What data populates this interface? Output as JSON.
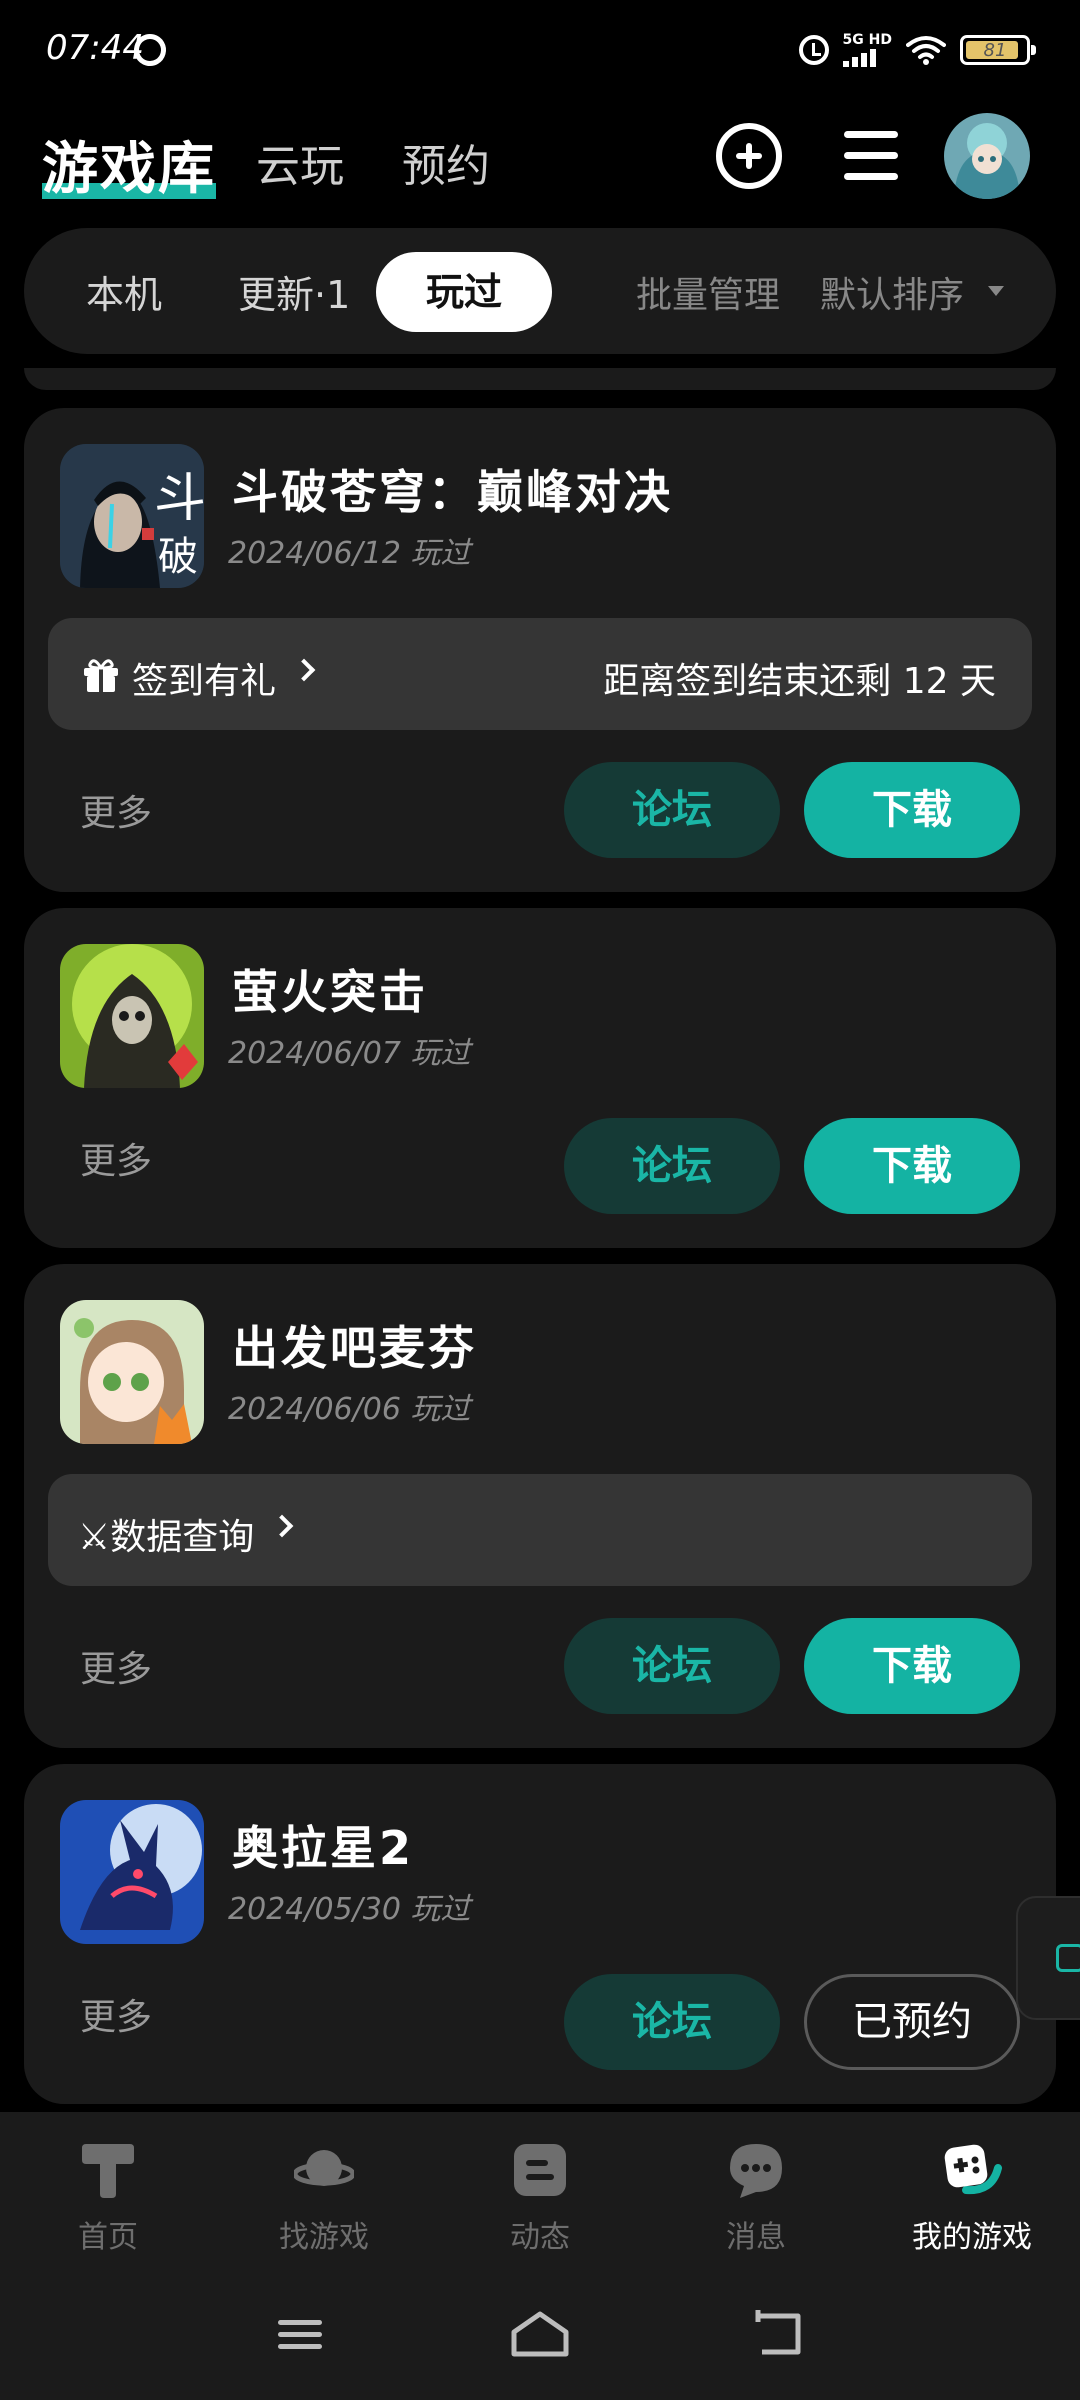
{
  "status_bar": {
    "time": "07:44",
    "network": "5G HD",
    "battery": "81"
  },
  "header": {
    "active_tab": "游戏库",
    "tabs": [
      "云玩",
      "预约"
    ]
  },
  "filter_bar": {
    "tabs": [
      "本机",
      "更新·1",
      "玩过"
    ],
    "active_tab": "玩过",
    "batch_manage": "批量管理",
    "sort": "默认排序"
  },
  "games": [
    {
      "name": "斗破苍穹：巅峰对决",
      "date": "2024/06/12 玩过",
      "banner": {
        "text": "签到有礼",
        "right": "距离签到结束还剩 12 天"
      },
      "more": "更多",
      "forum": "论坛",
      "action": "下载"
    },
    {
      "name": "萤火突击",
      "date": "2024/06/07 玩过",
      "more": "更多",
      "forum": "论坛",
      "action": "下载"
    },
    {
      "name": "出发吧麦芬",
      "date": "2024/06/06 玩过",
      "banner": {
        "text": "⚔数据查询"
      },
      "more": "更多",
      "forum": "论坛",
      "action": "下载"
    },
    {
      "name": "奥拉星2",
      "date": "2024/05/30 玩过",
      "more": "更多",
      "forum": "论坛",
      "action": "已预约"
    }
  ],
  "bottom_nav": {
    "items": [
      "首页",
      "找游戏",
      "动态",
      "消息",
      "我的游戏"
    ],
    "active": "我的游戏"
  },
  "colors": {
    "accent": "#14b3a3",
    "forum_bg": "#153a36",
    "card_bg": "#1b1b1b",
    "banner_bg": "#353535"
  }
}
